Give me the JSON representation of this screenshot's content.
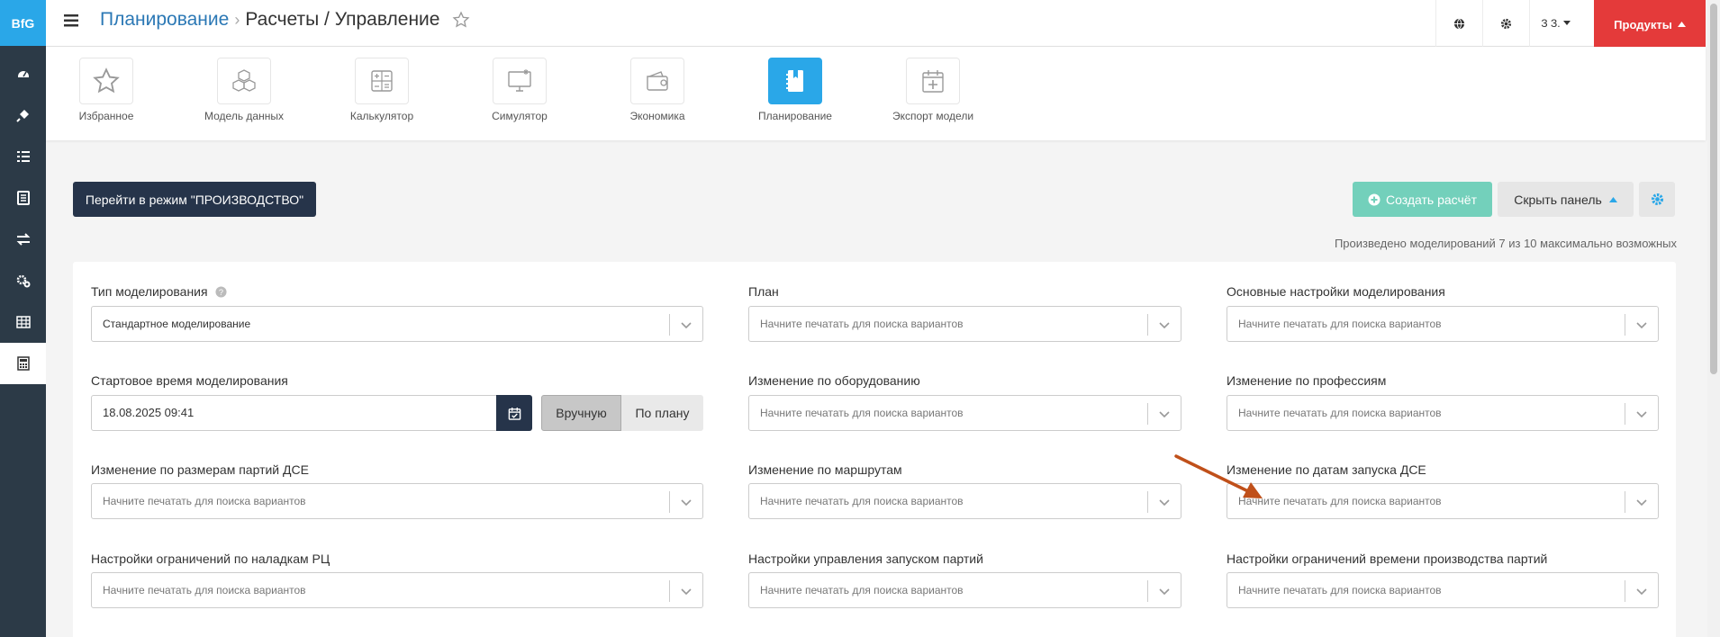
{
  "app": {
    "logo": "BfG"
  },
  "sidebar": {
    "items": [
      {
        "icon": "dashboard-icon"
      },
      {
        "icon": "plug-icon"
      },
      {
        "icon": "list-icon"
      },
      {
        "icon": "document-icon"
      },
      {
        "icon": "exchange-icon"
      },
      {
        "icon": "gears-icon"
      },
      {
        "icon": "table-icon"
      },
      {
        "icon": "calculator-icon",
        "active": true
      }
    ]
  },
  "header": {
    "breadcrumb_root": "Планирование",
    "breadcrumb_separator": "›",
    "breadcrumb_current": "Расчеты / Управление",
    "user_label": "З З.",
    "products_label": "Продукты"
  },
  "modules": [
    {
      "label": "Избранное",
      "icon": "star-icon"
    },
    {
      "label": "Модель данных",
      "icon": "cubes-icon"
    },
    {
      "label": "Калькулятор",
      "icon": "calculator-icon"
    },
    {
      "label": "Симулятор",
      "icon": "monitor-icon"
    },
    {
      "label": "Экономика",
      "icon": "wallet-icon"
    },
    {
      "label": "Планирование",
      "icon": "notebook-icon",
      "active": true
    },
    {
      "label": "Экспорт модели",
      "icon": "calendar-plus-icon"
    }
  ],
  "actions": {
    "production_mode": "Перейти в режим \"ПРОИЗВОДСТВО\"",
    "create": "Создать расчёт",
    "hide_panel": "Скрыть панель",
    "counter": "Произведено моделирований 7 из 10 максимально возможных"
  },
  "form": {
    "placeholder": "Начните печатать для поиска вариантов",
    "fields": {
      "sim_type": {
        "label": "Тип моделирования",
        "value": "Стандартное моделирование"
      },
      "plan": {
        "label": "План"
      },
      "main_settings": {
        "label": "Основные настройки моделирования"
      },
      "start_time": {
        "label": "Стартовое время моделирования",
        "value": "18.08.2025 09:41",
        "manual": "Вручную",
        "by_plan": "По плану"
      },
      "equipment": {
        "label": "Изменение по оборудованию"
      },
      "professions": {
        "label": "Изменение по профессиям"
      },
      "batch_sizes": {
        "label": "Изменение по размерам партий ДСЕ"
      },
      "routes": {
        "label": "Изменение по маршрутам"
      },
      "launch_dates": {
        "label": "Изменение по датам запуска ДСЕ"
      },
      "setup_limits": {
        "label": "Настройки ограничений по наладкам РЦ"
      },
      "launch_control": {
        "label": "Настройки управления запуском партий"
      },
      "time_limits": {
        "label": "Настройки ограничений времени производства партий"
      }
    }
  },
  "colors": {
    "accent": "#2aa7e8",
    "dark": "#26344a",
    "danger": "#e43a3a",
    "success": "#73d0bb",
    "annotation": "#c0501a"
  }
}
